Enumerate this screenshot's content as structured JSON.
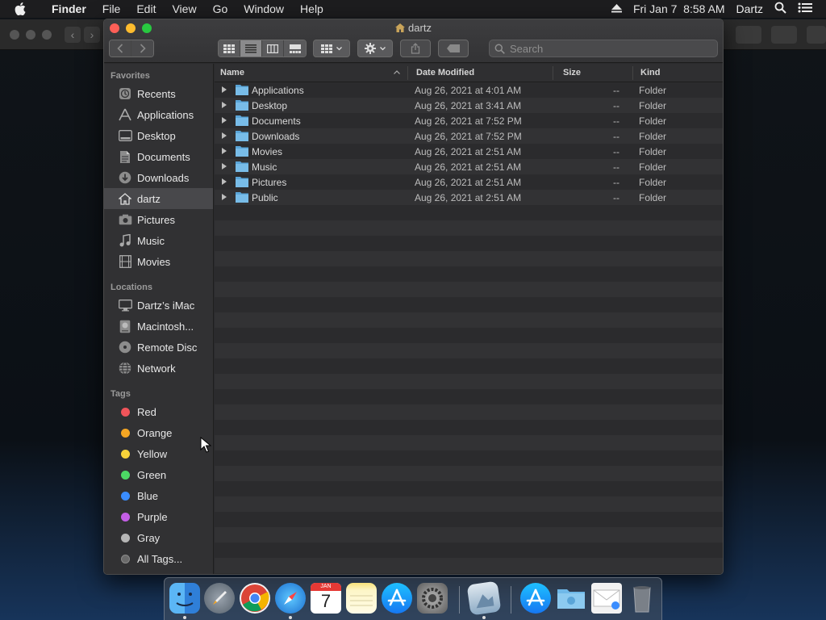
{
  "menubar": {
    "app_name": "Finder",
    "menus": [
      "File",
      "Edit",
      "View",
      "Go",
      "Window",
      "Help"
    ],
    "datetime": "Fri Jan 7  8:58 AM",
    "user": "Dartz"
  },
  "window": {
    "title": "dartz",
    "search_placeholder": "Search"
  },
  "sidebar": {
    "favorites_heading": "Favorites",
    "favorites": [
      {
        "label": "Recents",
        "icon": "clock-icon"
      },
      {
        "label": "Applications",
        "icon": "applications-icon"
      },
      {
        "label": "Desktop",
        "icon": "desktop-icon"
      },
      {
        "label": "Documents",
        "icon": "document-icon"
      },
      {
        "label": "Downloads",
        "icon": "download-icon"
      },
      {
        "label": "dartz",
        "icon": "home-icon",
        "selected": true
      },
      {
        "label": "Pictures",
        "icon": "camera-icon"
      },
      {
        "label": "Music",
        "icon": "music-note-icon"
      },
      {
        "label": "Movies",
        "icon": "film-icon"
      }
    ],
    "locations_heading": "Locations",
    "locations": [
      {
        "label": "Dartz’s iMac",
        "icon": "imac-icon"
      },
      {
        "label": "Macintosh...",
        "icon": "hard-drive-icon"
      },
      {
        "label": "Remote Disc",
        "icon": "disc-icon"
      },
      {
        "label": "Network",
        "icon": "globe-icon"
      }
    ],
    "tags_heading": "Tags",
    "tags": [
      {
        "label": "Red",
        "color": "#f0545a"
      },
      {
        "label": "Orange",
        "color": "#f5a623"
      },
      {
        "label": "Yellow",
        "color": "#f7d23a"
      },
      {
        "label": "Green",
        "color": "#4cd964"
      },
      {
        "label": "Blue",
        "color": "#3a8dff"
      },
      {
        "label": "Purple",
        "color": "#c35ee6"
      },
      {
        "label": "Gray",
        "color": "#b5b5b5"
      },
      {
        "label": "All Tags...",
        "color": "#6a6a6a"
      }
    ]
  },
  "list": {
    "columns": {
      "name": "Name",
      "date": "Date Modified",
      "size": "Size",
      "kind": "Kind"
    },
    "rows": [
      {
        "name": "Applications",
        "date": "Aug 26, 2021 at 4:01 AM",
        "size": "--",
        "kind": "Folder"
      },
      {
        "name": "Desktop",
        "date": "Aug 26, 2021 at 3:41 AM",
        "size": "--",
        "kind": "Folder"
      },
      {
        "name": "Documents",
        "date": "Aug 26, 2021 at 7:52 PM",
        "size": "--",
        "kind": "Folder"
      },
      {
        "name": "Downloads",
        "date": "Aug 26, 2021 at 7:52 PM",
        "size": "--",
        "kind": "Folder"
      },
      {
        "name": "Movies",
        "date": "Aug 26, 2021 at 2:51 AM",
        "size": "--",
        "kind": "Folder"
      },
      {
        "name": "Music",
        "date": "Aug 26, 2021 at 2:51 AM",
        "size": "--",
        "kind": "Folder"
      },
      {
        "name": "Pictures",
        "date": "Aug 26, 2021 at 2:51 AM",
        "size": "--",
        "kind": "Folder"
      },
      {
        "name": "Public",
        "date": "Aug 26, 2021 at 2:51 AM",
        "size": "--",
        "kind": "Folder"
      }
    ]
  },
  "dock": {
    "items": [
      "finder-icon",
      "launchpad-icon",
      "chrome-icon",
      "safari-icon",
      "calendar-icon",
      "notes-icon",
      "app-store-icon",
      "system-preferences-icon",
      "preview-icon",
      "app-store-folder-icon",
      "downloads-folder-icon",
      "mail-icon",
      "trash-icon"
    ],
    "calendar_month": "JAN",
    "calendar_day": "7"
  }
}
